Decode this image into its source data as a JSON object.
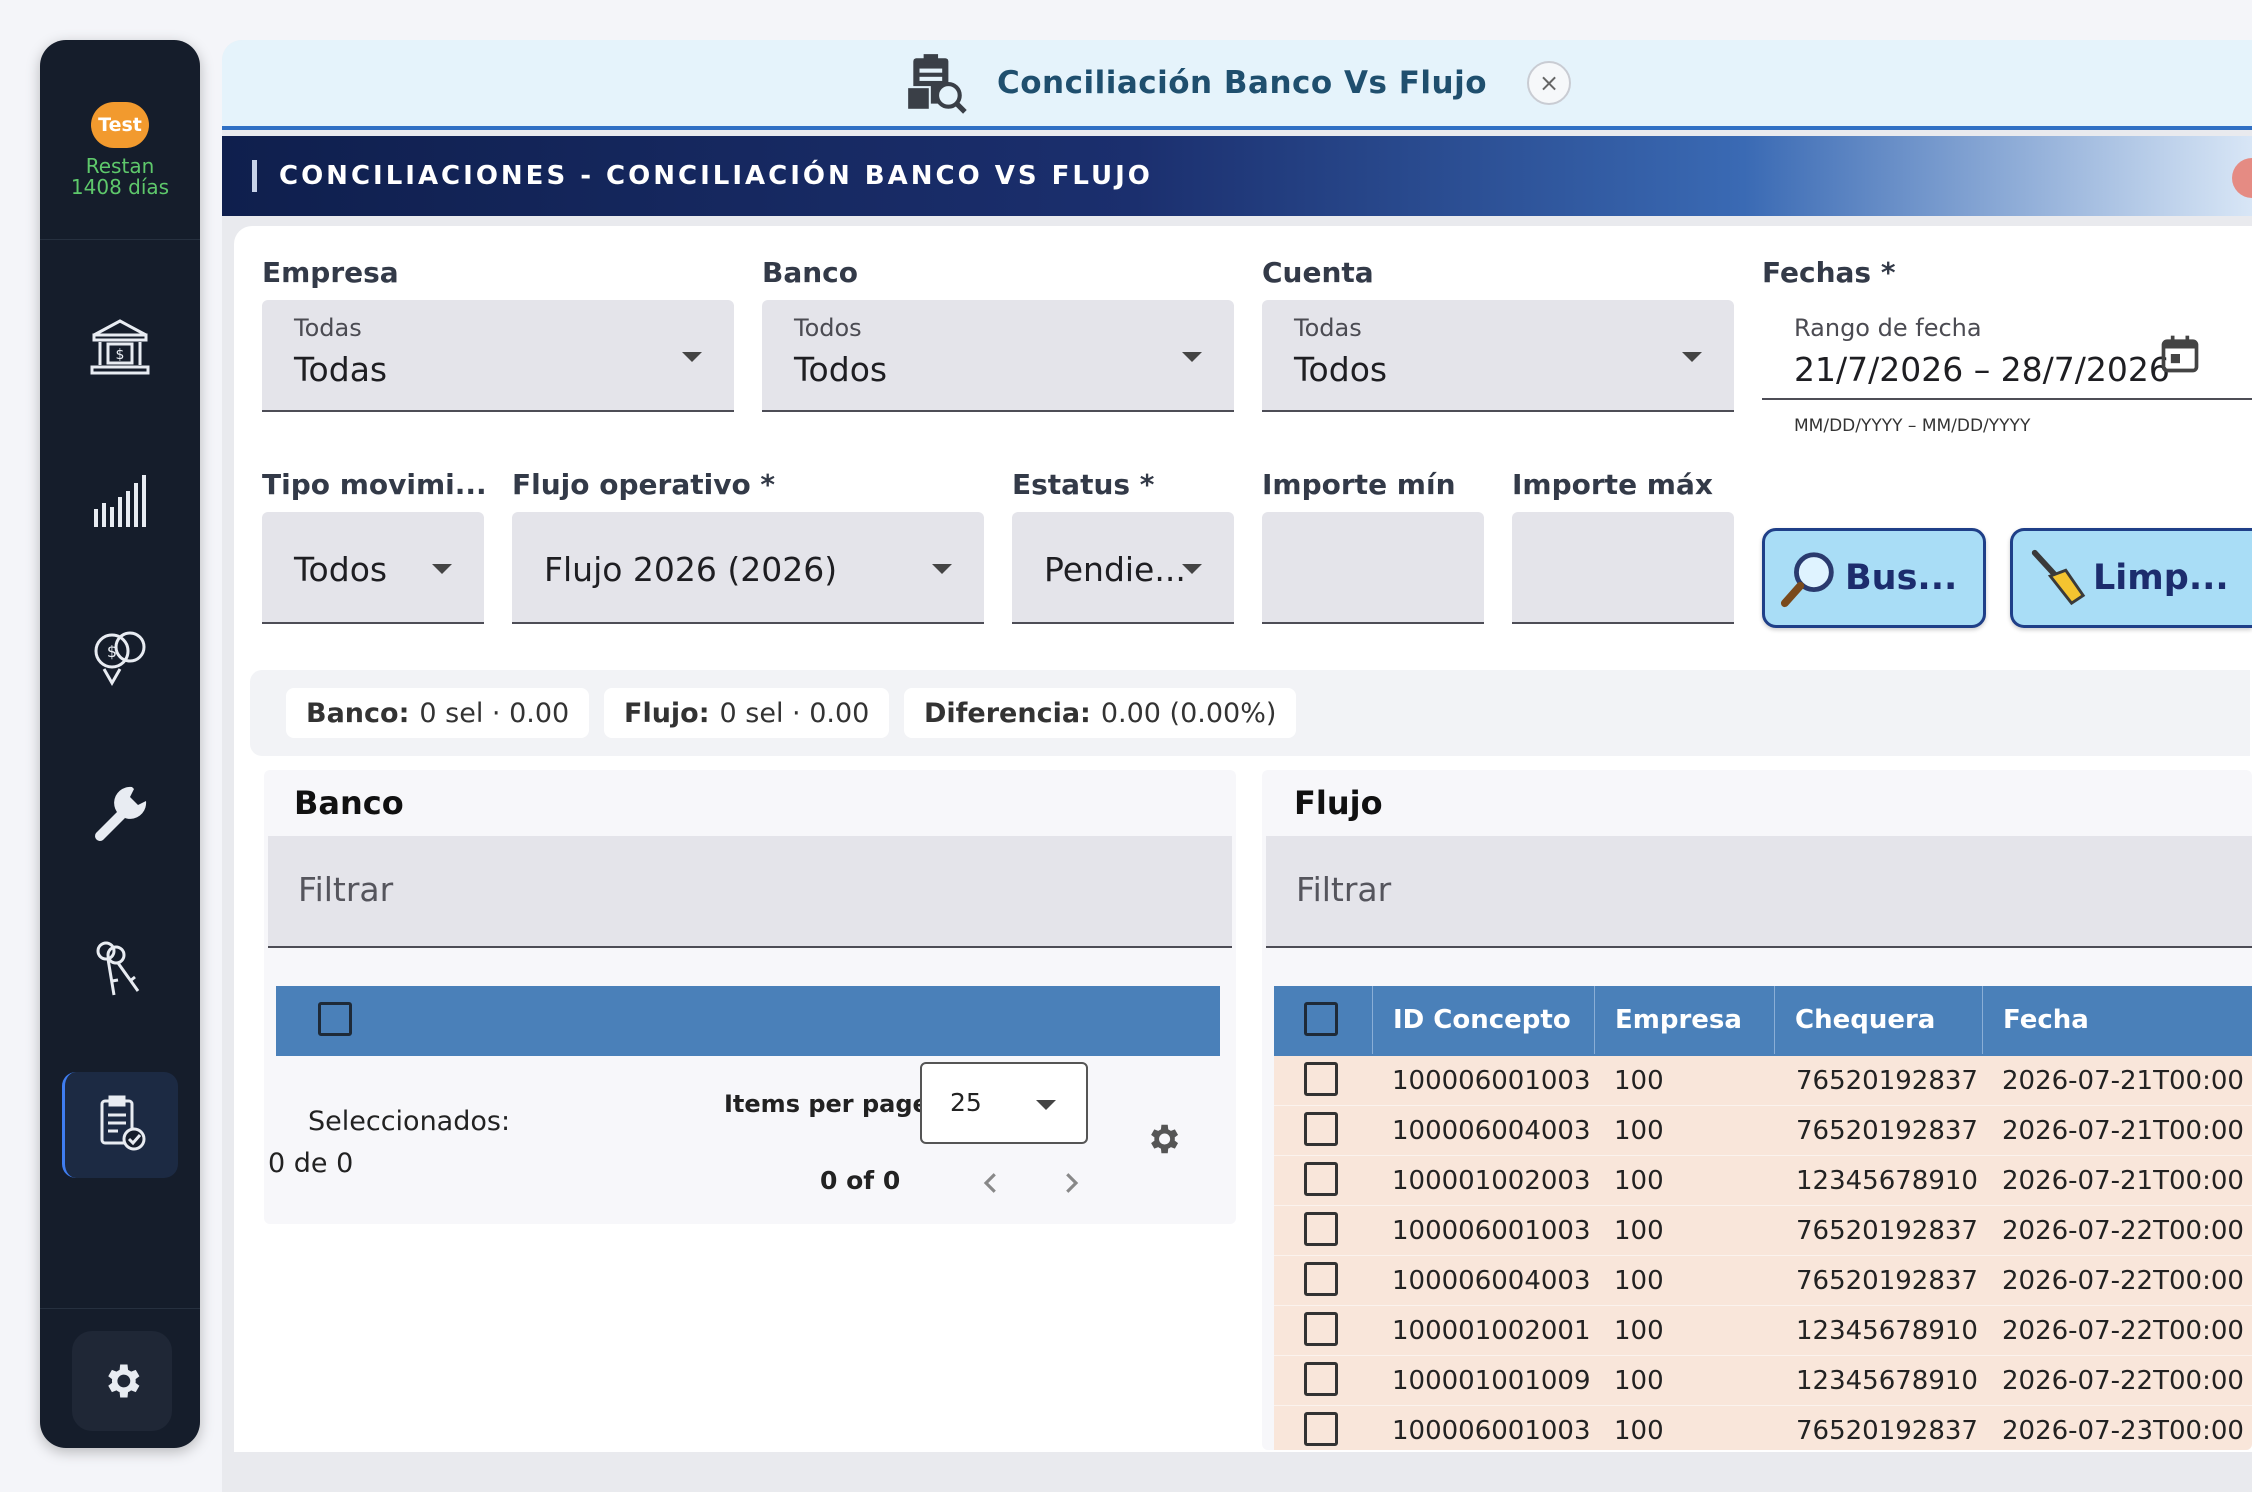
{
  "sidebar": {
    "badge": "Test",
    "remaining_line1": "Restan",
    "remaining_line2": "1408 días",
    "items": [
      {
        "icon": "bank-icon"
      },
      {
        "icon": "bar-chart-icon"
      },
      {
        "icon": "money-location-icon"
      },
      {
        "icon": "wrench-icon"
      },
      {
        "icon": "keys-icon"
      },
      {
        "icon": "reconciliation-icon",
        "active": true
      }
    ],
    "settings_icon": "gear-icon"
  },
  "tab": {
    "title": "Conciliación Banco Vs Flujo",
    "close": "×"
  },
  "banner": {
    "title": "CONCILIACIONES - CONCILIACIÓN BANCO VS FLUJO"
  },
  "filters": {
    "empresa": {
      "label": "Empresa",
      "small": "Todas",
      "value": "Todas"
    },
    "banco": {
      "label": "Banco",
      "small": "Todos",
      "value": "Todos"
    },
    "cuenta": {
      "label": "Cuenta",
      "small": "Todas",
      "value": "Todos"
    },
    "fechas": {
      "label": "Fechas *",
      "small": "Rango de fecha",
      "value": "21/7/2026 – 28/7/2026",
      "hint": "MM/DD/YYYY – MM/DD/YYYY"
    },
    "tipo": {
      "label": "Tipo movimi...",
      "value": "Todos"
    },
    "flujo": {
      "label": "Flujo operativo *",
      "value": "Flujo 2026 (2026)"
    },
    "estatus": {
      "label": "Estatus *",
      "value": "Pendie..."
    },
    "importe_min": {
      "label": "Importe mín",
      "value": ""
    },
    "importe_max": {
      "label": "Importe máx",
      "value": ""
    },
    "buscar": "Bus...",
    "limpiar": "Limp..."
  },
  "summary": {
    "banco_label": "Banco:",
    "banco_value": "0 sel · 0.00",
    "flujo_label": "Flujo:",
    "flujo_value": "0 sel · 0.00",
    "diferencia_label": "Diferencia:",
    "diferencia_value": "0.00 (0.00%)"
  },
  "banco_panel": {
    "title": "Banco",
    "filter_placeholder": "Filtrar",
    "selected_label": "Seleccionados:",
    "selected_value": "0 de 0",
    "items_per_page_label": "Items per page:",
    "items_per_page": "25",
    "range": "0 of 0"
  },
  "flujo_panel": {
    "title": "Flujo",
    "filter_placeholder": "Filtrar",
    "columns": [
      "ID Concepto",
      "Empresa",
      "Chequera",
      "Fecha"
    ],
    "rows": [
      [
        "100006001003",
        "100",
        "76520192837",
        "2026-07-21T00:00"
      ],
      [
        "100006004003",
        "100",
        "76520192837",
        "2026-07-21T00:00"
      ],
      [
        "100001002003",
        "100",
        "12345678910",
        "2026-07-21T00:00"
      ],
      [
        "100006001003",
        "100",
        "76520192837",
        "2026-07-22T00:00"
      ],
      [
        "100006004003",
        "100",
        "76520192837",
        "2026-07-22T00:00"
      ],
      [
        "100001002001",
        "100",
        "12345678910",
        "2026-07-22T00:00"
      ],
      [
        "100001001009",
        "100",
        "12345678910",
        "2026-07-22T00:00"
      ],
      [
        "100006001003",
        "100",
        "76520192837",
        "2026-07-23T00:00"
      ]
    ]
  }
}
